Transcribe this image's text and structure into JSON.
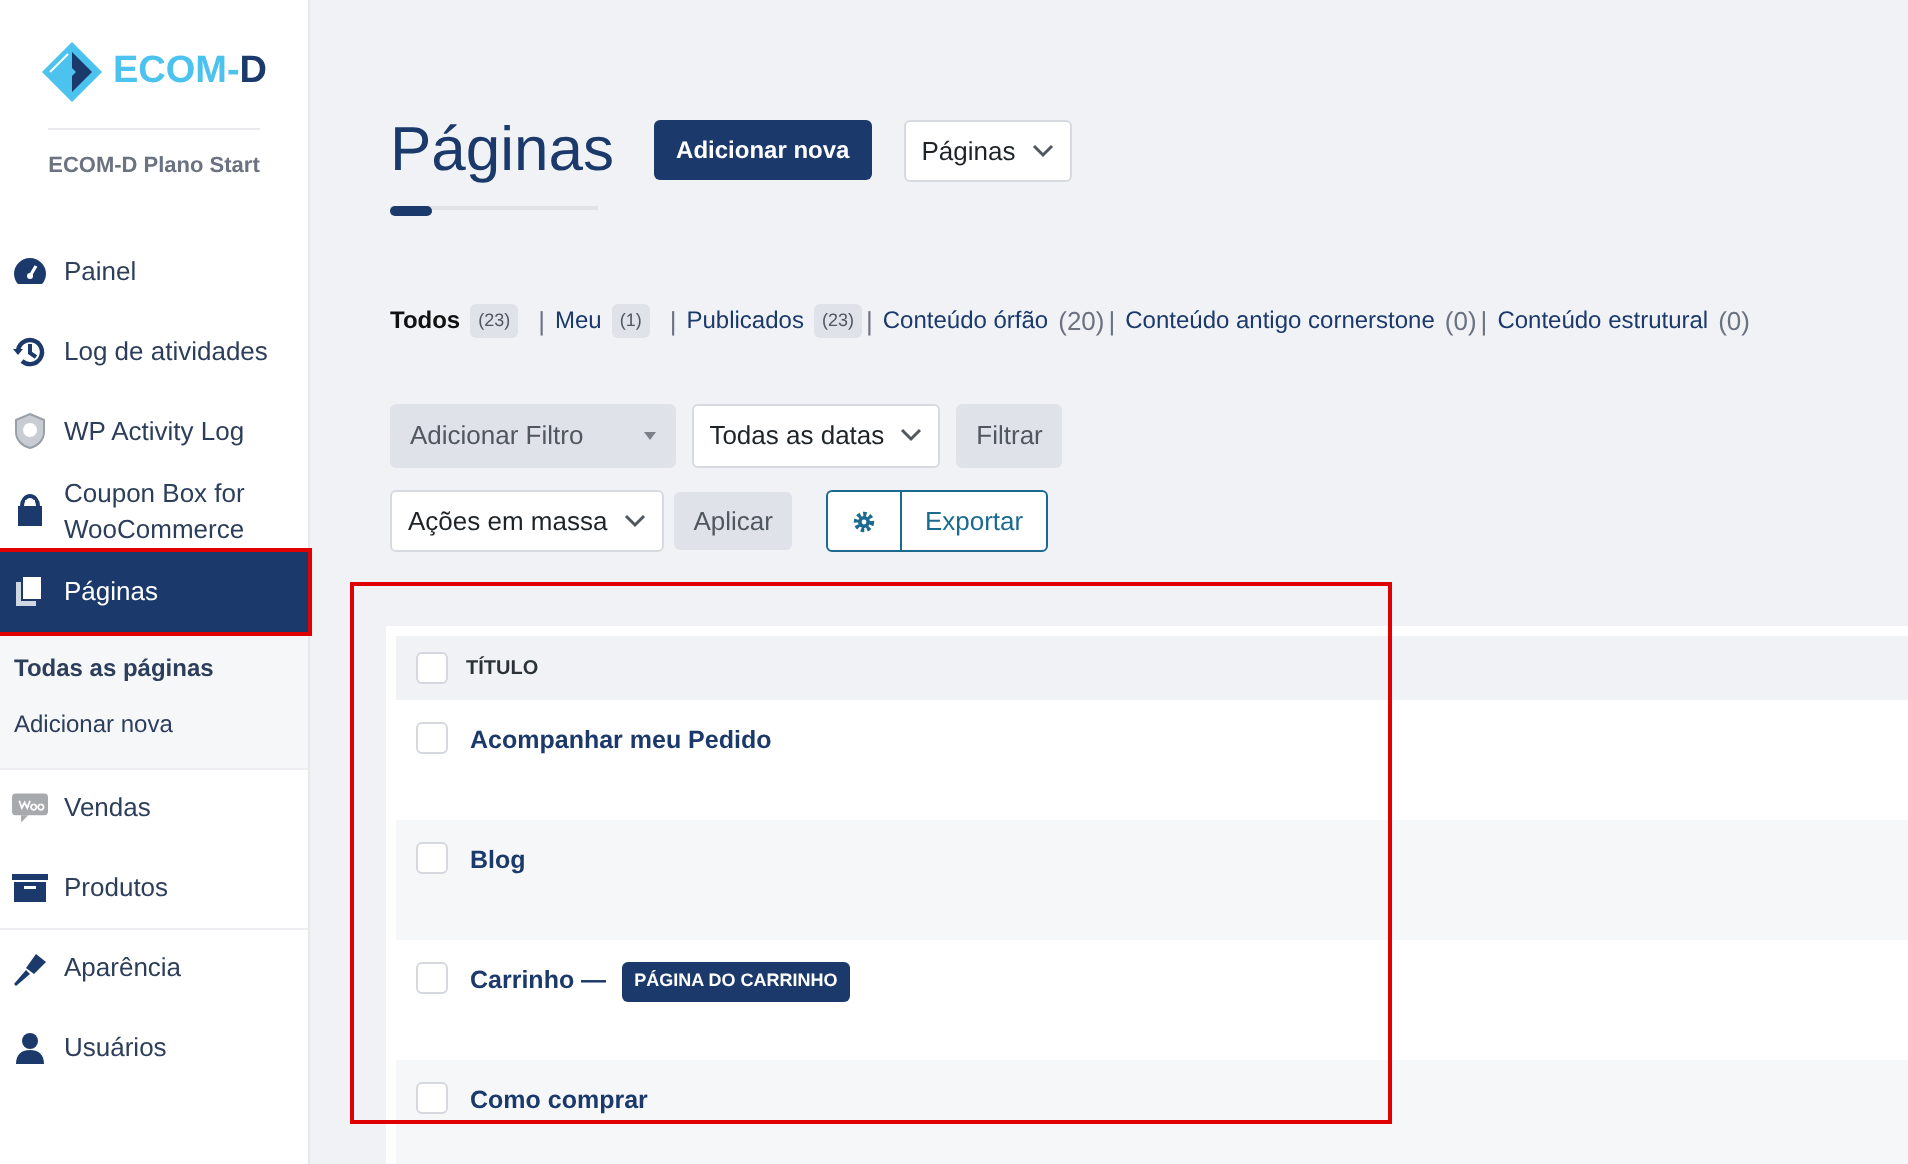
{
  "sidebar": {
    "logo_text_primary": "ECOM-",
    "logo_text_secondary": "D",
    "plan": "ECOM-D Plano Start",
    "items": [
      {
        "label": "Painel",
        "selected": false,
        "highlighted": false,
        "divider_before": false
      },
      {
        "label": "Log de atividades",
        "selected": false,
        "highlighted": false,
        "divider_before": false
      },
      {
        "label": "WP Activity Log",
        "selected": false,
        "highlighted": false,
        "divider_before": false
      },
      {
        "label": "Coupon Box for WooCommerce",
        "selected": false,
        "highlighted": false,
        "divider_before": false
      },
      {
        "label": "Páginas",
        "selected": true,
        "highlighted": true,
        "divider_before": false,
        "children": [
          {
            "label": "Todas as páginas",
            "selected": true
          },
          {
            "label": "Adicionar nova",
            "selected": false
          }
        ]
      },
      {
        "label": "Vendas",
        "selected": false,
        "highlighted": false,
        "divider_before": true
      },
      {
        "label": "Produtos",
        "selected": false,
        "highlighted": false,
        "divider_before": false
      },
      {
        "label": "Aparência",
        "selected": false,
        "highlighted": false,
        "divider_before": true
      },
      {
        "label": "Usuários",
        "selected": false,
        "highlighted": false,
        "divider_before": false
      }
    ]
  },
  "header": {
    "title": "Páginas",
    "add_button": "Adicionar nova",
    "type_select": "Páginas"
  },
  "views": [
    {
      "label": "Todos",
      "count": "(23)",
      "kind": "badge",
      "selected": true
    },
    {
      "separator": "|",
      "label": "Meu",
      "count": "(1)",
      "kind": "badge",
      "selected": false
    },
    {
      "separator": "|",
      "label": "Publicados",
      "count": "(23)",
      "kind": "badge",
      "selected": false
    },
    {
      "separator": "|",
      "label": "Conteúdo órfão",
      "count": "(20)",
      "kind": "plain",
      "selected": false
    },
    {
      "separator": "|",
      "label": "Conteúdo antigo cornerstone",
      "count": "(0)",
      "kind": "plain",
      "selected": false
    },
    {
      "separator": "|",
      "label": "Conteúdo estrutural",
      "count": "(0)",
      "kind": "plain",
      "selected": false
    }
  ],
  "filters": {
    "add_filter": "Adicionar Filtro",
    "dates": "Todas as datas",
    "filter_button": "Filtrar",
    "bulk_actions": "Ações em massa",
    "apply_button": "Aplicar",
    "export_button": "Exportar"
  },
  "table": {
    "highlighted": true,
    "select_all_checked": false,
    "columns": [
      "TÍTULO"
    ],
    "rows": [
      {
        "title": "Acompanhar meu Pedido",
        "checked": false
      },
      {
        "title": "Blog",
        "checked": false
      },
      {
        "title": "Carrinho —",
        "state_badge": "PÁGINA DO CARRINHO",
        "checked": false
      },
      {
        "title": "Como comprar",
        "checked": false
      }
    ]
  }
}
